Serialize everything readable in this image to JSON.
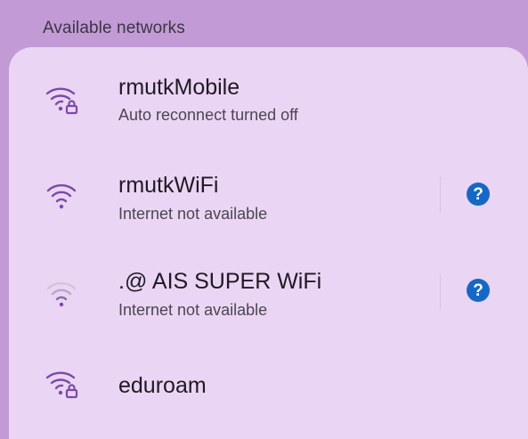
{
  "header": {
    "title": "Available networks"
  },
  "networks": [
    {
      "name": "rmutkMobile",
      "status": "Auto reconnect turned off",
      "icon": "wifi-lock-icon",
      "has_help": false
    },
    {
      "name": "rmutkWiFi",
      "status": "Internet not available",
      "icon": "wifi-icon",
      "has_help": true,
      "help_symbol": "?"
    },
    {
      "name": ".@ AIS SUPER WiFi",
      "status": "Internet not available",
      "icon": "wifi-weak-icon",
      "has_help": true,
      "help_symbol": "?"
    },
    {
      "name": "eduroam",
      "status": "",
      "icon": "wifi-lock-icon",
      "has_help": false
    }
  ],
  "colors": {
    "header_bg": "#c29bd6",
    "card_bg": "#ebd5f4",
    "icon_strong": "#7c4aa6",
    "icon_weak": "#b9a8c4",
    "help_blue": "#1668c6"
  }
}
